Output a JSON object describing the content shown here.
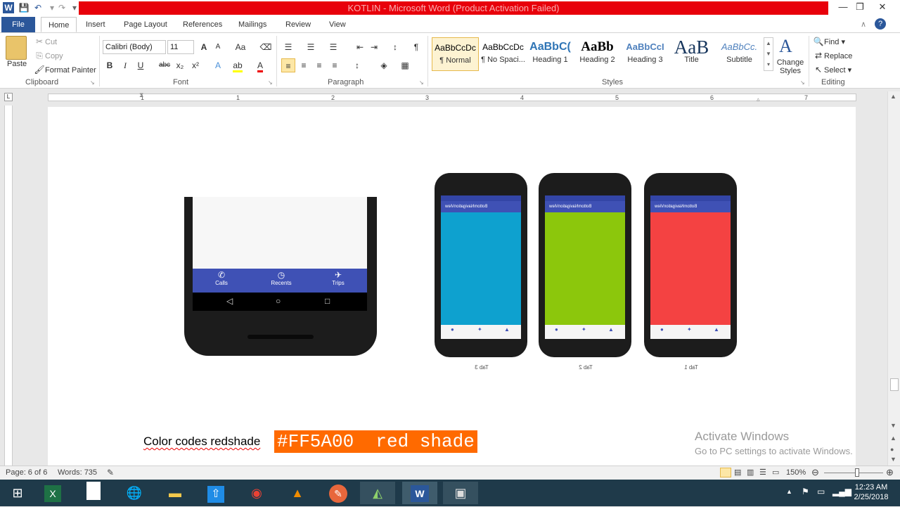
{
  "window": {
    "title": "KOTLIN - Microsoft Word (Product Activation Failed)",
    "controls": {
      "minimize": "—",
      "restore": "❐",
      "close": "✕"
    },
    "help": "?"
  },
  "tabs": [
    "File",
    "Home",
    "Insert",
    "Page Layout",
    "References",
    "Mailings",
    "Review",
    "View"
  ],
  "ribbon": {
    "clipboard": {
      "paste": "Paste",
      "cut": "Cut",
      "copy": "Copy",
      "format_painter": "Format Painter",
      "label": "Clipboard"
    },
    "font": {
      "name": "Calibri (Body)",
      "size": "11",
      "label": "Font",
      "bold": "B",
      "italic": "I",
      "underline": "U",
      "strike": "abc",
      "sub": "x₂",
      "sup": "x²",
      "grow": "A",
      "shrink": "A",
      "case": "Aa"
    },
    "paragraph": {
      "label": "Paragraph",
      "pilcrow": "¶"
    },
    "styles": {
      "label": "Styles",
      "items": [
        {
          "sample": "AaBbCcDc",
          "name": "¶ Normal"
        },
        {
          "sample": "AaBbCcDc",
          "name": "¶ No Spaci..."
        },
        {
          "sample": "AaBbC(",
          "name": "Heading 1"
        },
        {
          "sample": "AaBb",
          "name": "Heading 2"
        },
        {
          "sample": "AaBbCcI",
          "name": "Heading 3"
        },
        {
          "sample": "AaB",
          "name": "Title"
        },
        {
          "sample": "AaBbCc.",
          "name": "Subtitle"
        }
      ],
      "change_styles": "Change Styles"
    },
    "editing": {
      "find": "Find",
      "replace": "Replace",
      "select": "Select",
      "label": "Editing"
    }
  },
  "ruler": {
    "numbers": [
      "1",
      "1",
      "2",
      "3",
      "4",
      "5",
      "6",
      "7"
    ]
  },
  "document": {
    "left_phone": {
      "tabs": [
        "Calls",
        "Recents",
        "Trips"
      ]
    },
    "right_phones": [
      {
        "caption": "Tab 3",
        "color": "#0ea1cf",
        "title": "BottomNavigationView"
      },
      {
        "caption": "Tab 2",
        "color": "#8cc70c",
        "title": "BottomNavigationView"
      },
      {
        "caption": "Tab 1",
        "color": "#f44242",
        "title": "BottomNavigationView"
      }
    ],
    "text_line": "Color codes redshade",
    "highlight": "#FF5A00  red shade",
    "highlight_color": "#ff6a00"
  },
  "watermark": {
    "line1": "Activate Windows",
    "line2": "Go to PC settings to activate Windows."
  },
  "status": {
    "page": "Page: 6 of 6",
    "words": "Words: 735",
    "zoom": "150%"
  },
  "taskbar": {
    "time": "12:23 AM",
    "date": "2/25/2018"
  }
}
